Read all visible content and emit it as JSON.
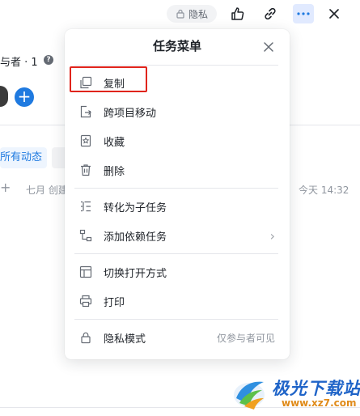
{
  "toolbar": {
    "privacy_label": "隐私",
    "icons": [
      "lock-icon",
      "thumbs-up-icon",
      "link-icon",
      "more-icon",
      "close-icon"
    ]
  },
  "background": {
    "participants_label": "与者 · 1",
    "help_symbol": "?",
    "add_symbol": "+",
    "tab_all_activity": "所有动态",
    "log_plus": "+",
    "log_created": "七月 创建",
    "log_time": "今天 14:32"
  },
  "menu": {
    "title": "任务菜单",
    "items": [
      {
        "label": "复制",
        "icon": "copy-icon"
      },
      {
        "label": "跨项目移动",
        "icon": "move-icon"
      },
      {
        "label": "收藏",
        "icon": "star-bookmark-icon"
      },
      {
        "label": "删除",
        "icon": "trash-icon"
      },
      {
        "label": "转化为子任务",
        "icon": "subtask-icon"
      },
      {
        "label": "添加依赖任务",
        "icon": "dependency-icon",
        "chevron": "›"
      },
      {
        "label": "切换打开方式",
        "icon": "layout-icon"
      },
      {
        "label": "打印",
        "icon": "printer-icon"
      },
      {
        "label": "隐私模式",
        "icon": "lock-icon",
        "right_text": "仅参与者可见"
      }
    ]
  },
  "watermark": {
    "title": "极光下载站",
    "url": "www.xz7.com"
  },
  "colors": {
    "accent": "#1f7ae0",
    "highlight_border": "#e0241c",
    "text_primary": "#1f2329",
    "text_secondary": "#8f959e"
  }
}
